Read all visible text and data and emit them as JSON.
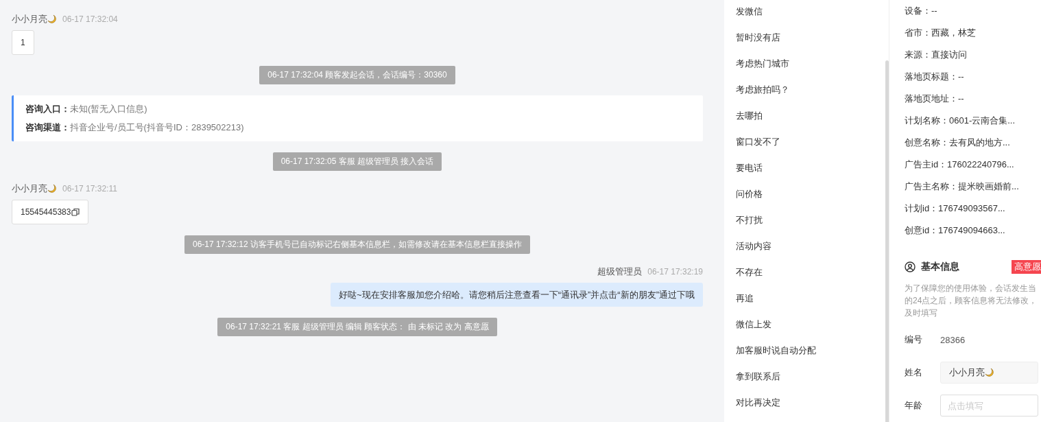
{
  "chat": {
    "messages": [
      {
        "kind": "customer",
        "sender": "小小月亮",
        "time": "06-17 17:32:04",
        "text": "1",
        "copyable": false
      },
      {
        "kind": "system",
        "text": "06-17 17:32:04 顾客发起会话，会话编号：30360"
      },
      {
        "kind": "info",
        "rows": [
          {
            "label": "咨询入口：",
            "value": "未知(暂无入口信息)"
          },
          {
            "label": "咨询渠道：",
            "value": "抖音企业号/员工号(抖音号ID：2839502213)"
          }
        ]
      },
      {
        "kind": "system",
        "text": "06-17 17:32:05 客服 超级管理员 接入会话"
      },
      {
        "kind": "customer",
        "sender": "小小月亮",
        "time": "06-17 17:32:11",
        "text": "15545445383",
        "copyable": true
      },
      {
        "kind": "system",
        "text": "06-17 17:32:12 访客手机号已自动标记右侧基本信息栏，如需修改请在基本信息栏直接操作"
      },
      {
        "kind": "agent",
        "sender": "超级管理员",
        "time": "06-17 17:32:19",
        "text": "好哒~现在安排客服加您介绍哈。请您稍后注意查看一下“通讯录”并点击“新的朋友”通过下哦"
      },
      {
        "kind": "system",
        "text": "06-17 17:32:21 客服 超级管理员 编辑 顾客状态： 由 未标记 改为 高意愿"
      }
    ]
  },
  "quick_replies": [
    "发微信",
    "暂时没有店",
    "考虑热门城市",
    "考虑旅拍吗？",
    "去哪拍",
    "窗口发不了",
    "要电话",
    "问价格",
    "不打扰",
    "活动内容",
    "不存在",
    "再追",
    "微信上发",
    "加客服时说自动分配",
    "拿到联系后",
    "对比再决定"
  ],
  "visit_info": [
    "设备：--",
    "省市：西藏，林芝",
    "来源：直接访问",
    "落地页标题：--",
    "落地页地址：--",
    "计划名称：0601-云南合集...",
    "创意名称：去有风的地方...",
    "广告主id：176022240796...",
    "广告主名称：提米映画婚前...",
    "计划id：176749093567...",
    "创意id：176749094663..."
  ],
  "basic_info": {
    "title": "基本信息",
    "status_tag": "高意愿",
    "note_lines": [
      "为了保障您的使用体验，会话发生当",
      "的24点之后，顾客信息将无法修改，",
      "及时填写"
    ],
    "fields": [
      {
        "kind": "text",
        "label": "编号",
        "value": "28366"
      },
      {
        "kind": "filled",
        "label": "姓名",
        "value": "小小月亮"
      },
      {
        "kind": "input",
        "label": "年龄",
        "placeholder": "点击填写"
      }
    ]
  }
}
